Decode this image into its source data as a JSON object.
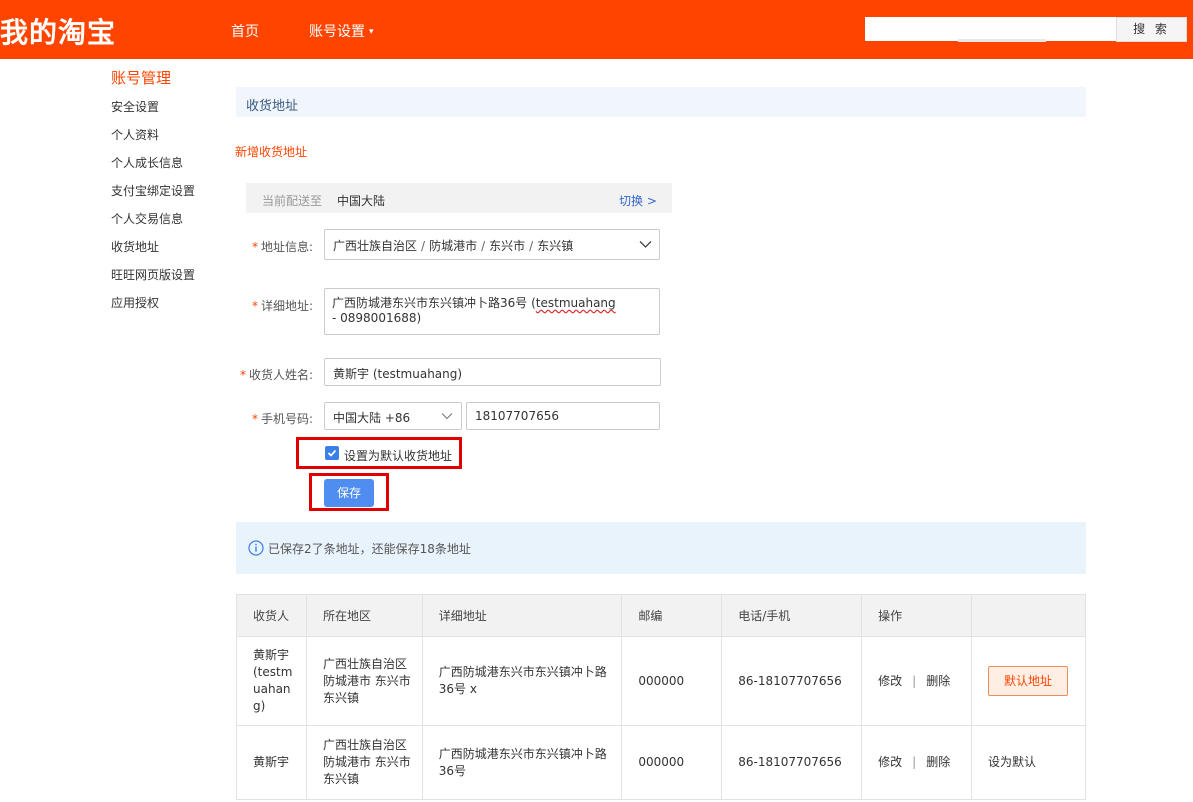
{
  "header": {
    "logo": "我的淘宝",
    "nav": [
      {
        "label": "首页"
      },
      {
        "label": "账号设置",
        "caret": "⌄"
      }
    ],
    "search": {
      "value": "",
      "button_label": "搜 索"
    }
  },
  "sidebar": {
    "title": "账号管理",
    "items": [
      "安全设置",
      "个人资料",
      "个人成长信息",
      "支付宝绑定设置",
      "个人交易信息",
      "收货地址",
      "旺旺网页版设置",
      "应用授权"
    ]
  },
  "main": {
    "section_title": "收货地址",
    "new_address_link": "新增收货地址",
    "delivery": {
      "label": "当前配送至",
      "value": "中国大陆",
      "switch": "切换 >"
    },
    "form": {
      "required_mark": "*",
      "region_label": "地址信息:",
      "region": {
        "province": "广西壮族自治区",
        "city": "防城港市",
        "county": "东兴市",
        "town": "东兴镇",
        "separator": "/"
      },
      "detail_label": "详细地址:",
      "detail_value_prefix": "广西防城港东兴市东兴镇冲卜路36号 (",
      "detail_value_misspelled": "testmuahang",
      "detail_value_suffix": " - 0898001688)",
      "name_label": "收货人姓名:",
      "name_value": "黄斯宇 (testmuahang)",
      "phone_label": "手机号码:",
      "country_code": "中国大陆 +86",
      "phone_value": "18107707656",
      "default_checkbox_label": "设置为默认收货地址",
      "default_checked": true,
      "save_label": "保存"
    },
    "info_text": "已保存2了条地址，还能保存18条地址",
    "table": {
      "headers": [
        "收货人",
        "所在地区",
        "详细地址",
        "邮编",
        "电话/手机",
        "操作",
        ""
      ],
      "rows": [
        {
          "name": "黄斯宇 (testm uahan g)",
          "region": "广西壮族自治区 防城港市 东兴市 东兴镇",
          "detail": "广西防城港东兴市东兴镇冲卜路36号 x",
          "zip": "000000",
          "phone": "86-18107707656",
          "edit": "修改",
          "delete": "删除",
          "status": "默认地址"
        },
        {
          "name": "黄斯宇",
          "region": "广西壮族自治区 防城港市 东兴市 东兴镇",
          "detail": "广西防城港东兴市东兴镇冲卜路36号",
          "zip": "000000",
          "phone": "86-18107707656",
          "edit": "修改",
          "delete": "删除",
          "status": "设为默认"
        }
      ],
      "op_separator": "|"
    }
  },
  "colors": {
    "brand": "#ff4400",
    "link": "#3366cc",
    "primary_button": "#4f8ef0",
    "highlight": "#e00000"
  }
}
